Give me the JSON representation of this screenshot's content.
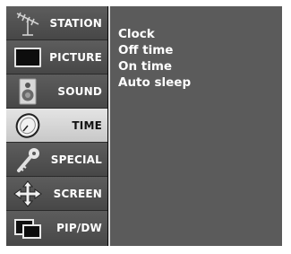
{
  "sidebar": {
    "items": [
      {
        "label": "STATION",
        "icon": "antenna-icon"
      },
      {
        "label": "PICTURE",
        "icon": "tv-screen-icon"
      },
      {
        "label": "SOUND",
        "icon": "speaker-icon"
      },
      {
        "label": "TIME",
        "icon": "clock-icon",
        "selected": true
      },
      {
        "label": "SPECIAL",
        "icon": "key-icon"
      },
      {
        "label": "SCREEN",
        "icon": "move-arrows-icon"
      },
      {
        "label": "PIP/DW",
        "icon": "pip-windows-icon"
      }
    ]
  },
  "submenu": {
    "items": [
      "Clock",
      "Off time",
      "On time",
      "Auto sleep"
    ]
  },
  "colors": {
    "menu_item_bg": "#535353",
    "selected_bg": "#d6d6d6",
    "panel_bg": "#5b5b5b",
    "frame": "#060606"
  }
}
